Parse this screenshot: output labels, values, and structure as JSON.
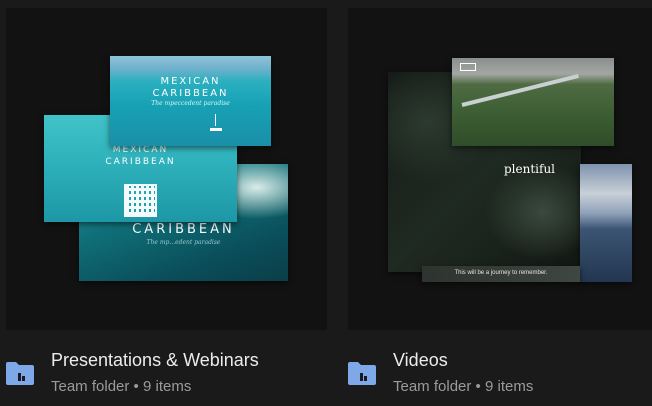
{
  "folders": [
    {
      "title": "Presentations & Webinars",
      "type_label": "Team folder",
      "separator": "•",
      "item_count": "9 items",
      "slides": {
        "front_title_1": "MEXICAN",
        "front_title_2": "CARIBBEAN",
        "front_sub": "The mpeccedent paradise",
        "mid_title_1": "MEXICAN",
        "mid_title_2": "CARIBBEAN",
        "back_title": "CARIBBEAN",
        "back_sub": "The mp...edent paradise"
      }
    },
    {
      "title": "Videos",
      "type_label": "Team folder",
      "separator": "•",
      "item_count": "9 items",
      "slides": {
        "overlay_word": "plentiful",
        "caption": "This will be a journey to remember."
      }
    }
  ],
  "colors": {
    "background": "#1a1a1a",
    "thumb_background": "#121212",
    "folder_icon": "#7fa8e8",
    "title_text": "#ececec",
    "meta_text": "#9b9b9b"
  },
  "icons": {
    "folder": "team-folder-icon"
  }
}
